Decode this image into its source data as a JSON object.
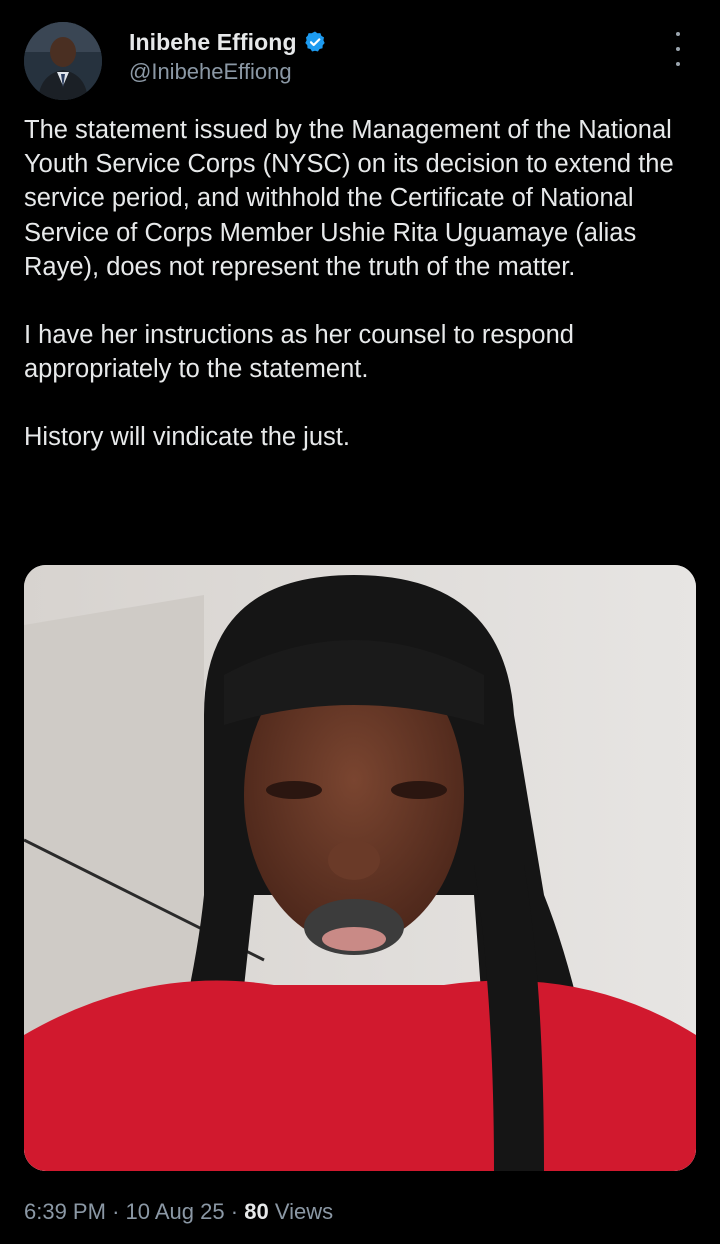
{
  "author": {
    "display_name": "Inibehe Effiong",
    "handle": "@InibeheEffiong",
    "verified": true,
    "verified_color": "#1d9bf0"
  },
  "tweet": {
    "paragraphs": [
      "The statement issued by the Management of the National Youth Service Corps (NYSC) on its decision to extend the service period, and withhold the Certificate of National Service of Corps Member Ushie Rita Uguamaye (alias Raye), does not represent the truth of the matter.",
      "I have her instructions as her counsel to respond appropriately to the statement.",
      "History will vindicate the just."
    ]
  },
  "meta": {
    "time": "6:39 PM",
    "separator": "·",
    "date": "10 Aug 25",
    "views_count": "80",
    "views_label": "Views"
  },
  "icons": {
    "verified": "verified-badge-icon",
    "more": "more-vertical-icon"
  }
}
